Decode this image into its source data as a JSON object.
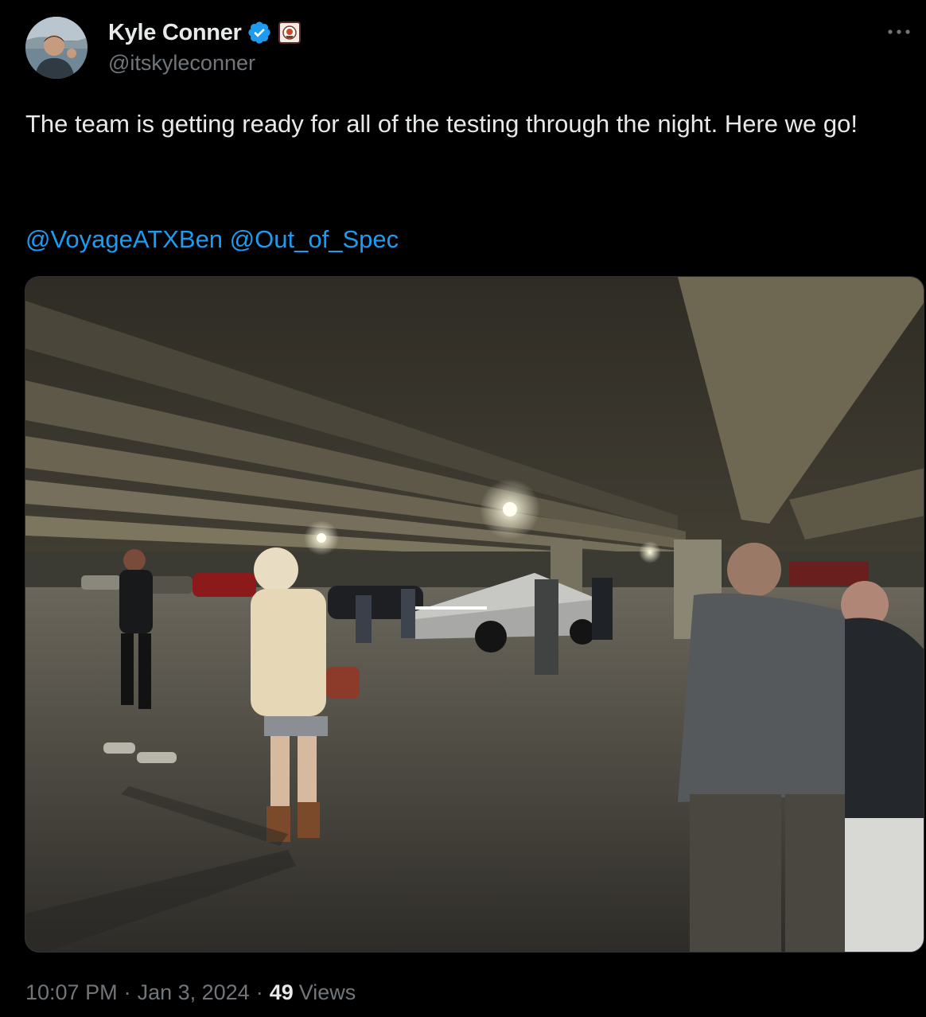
{
  "author": {
    "display_name": "Kyle Conner",
    "handle": "@itskyleconner",
    "verified": true,
    "avatar_icon": "user-avatar",
    "affiliate_badge_icon": "affiliate-badge-icon"
  },
  "tweet": {
    "text": "The team is getting ready for all of the testing through the night. Here we go!",
    "mentions": [
      "@VoyageATXBen",
      "@Out_of_Spec"
    ],
    "media_description_icon": "photo-parking-garage"
  },
  "meta": {
    "time": "10:07 PM",
    "separator": "·",
    "date": "Jan 3, 2024",
    "views_count": "49",
    "views_label": "Views"
  },
  "colors": {
    "background": "#000000",
    "text_primary": "#e7e9ea",
    "text_secondary": "#71767b",
    "link": "#1d9bf0",
    "verified_badge": "#1d9bf0"
  }
}
